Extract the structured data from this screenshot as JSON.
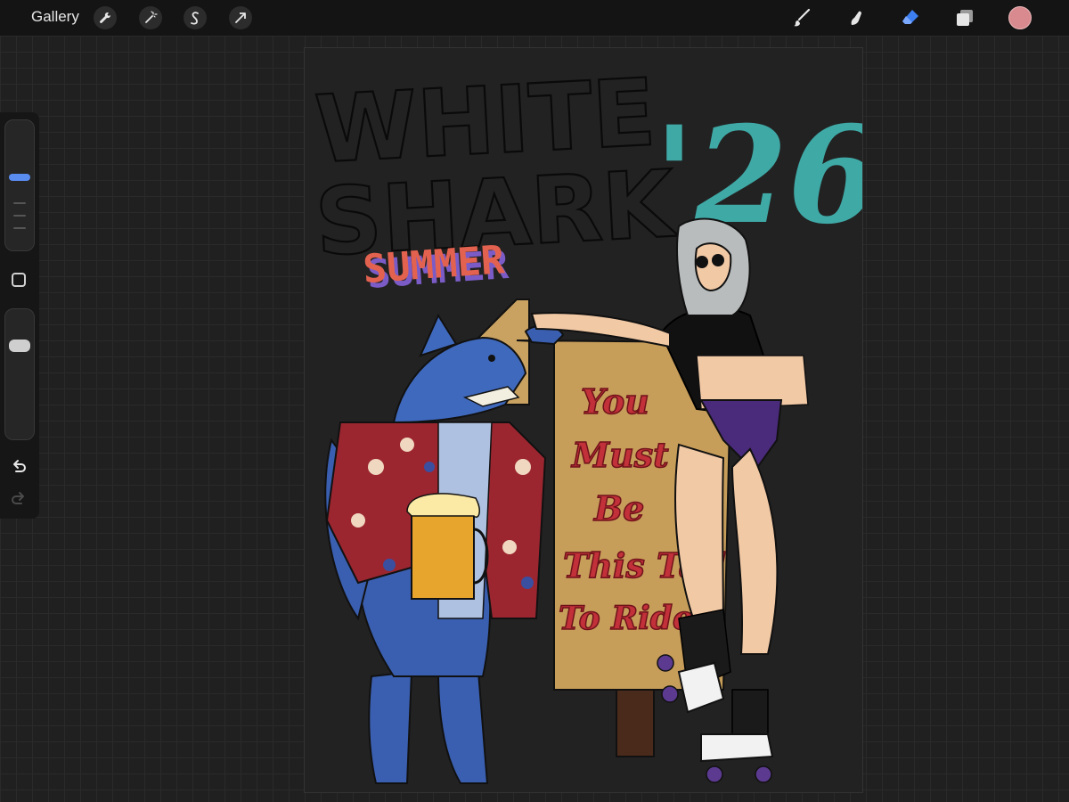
{
  "toolbar": {
    "gallery_label": "Gallery",
    "left_tools": [
      "wrench-icon",
      "magic-wand-icon",
      "selection-icon",
      "transform-arrow-icon"
    ],
    "right_tools": [
      "brush-icon",
      "smudge-icon",
      "eraser-icon",
      "layers-icon",
      "color-swatch"
    ],
    "active_tool": "eraser",
    "current_color": "#d98a8e",
    "accent_color": "#3d7ff0"
  },
  "sidebar": {
    "brush_size_level": 0.65,
    "opacity_level": 0.75,
    "tools": [
      "modify-square",
      "undo-icon",
      "redo-icon"
    ]
  },
  "artwork": {
    "title_line1": "WHITE",
    "title_line2": "SHARK",
    "year": "'26",
    "summer": "SUMMER",
    "sign_lines": [
      "You",
      "Must",
      "Be",
      "This Tall",
      "To Ride"
    ]
  }
}
